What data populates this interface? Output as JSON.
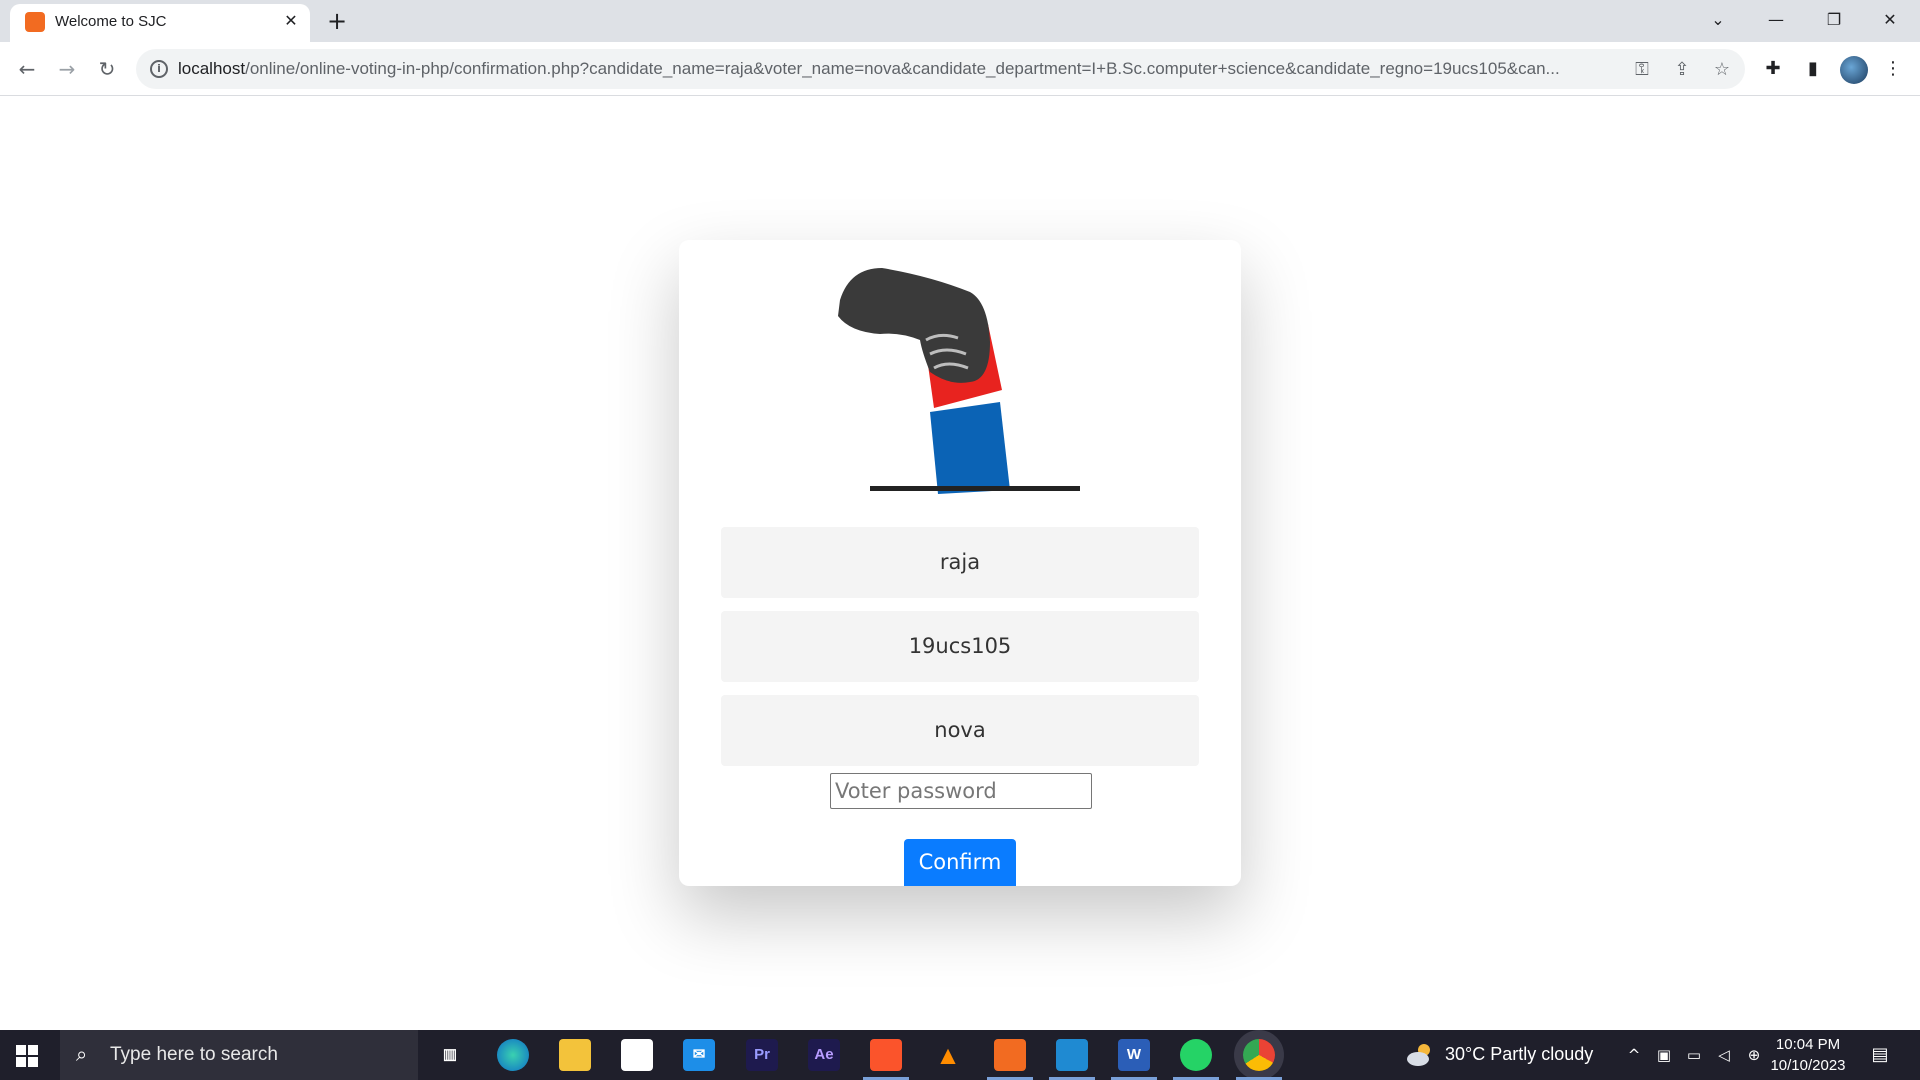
{
  "browser": {
    "tab_title": "Welcome to SJC",
    "tab_close": "✕",
    "new_tab": "+",
    "url_host": "localhost",
    "url_path": "/online/online-voting-in-php/confirmation.php?candidate_name=raja&voter_name=nova&candidate_department=I+B.Sc.computer+science&candidate_regno=19ucs105&can..."
  },
  "form": {
    "candidate_name": "raja",
    "candidate_regno": "19ucs105",
    "voter_name": "nova",
    "password_placeholder": "Voter password",
    "confirm_label": "Confirm"
  },
  "taskbar": {
    "search_placeholder": "Type here to search",
    "weather": "30°C  Partly cloudy",
    "time": "10:04 PM",
    "date": "10/10/2023",
    "apps": [
      "task-view",
      "edge",
      "file-explorer",
      "microsoft-store",
      "mail",
      "premiere-pro",
      "after-effects",
      "brave",
      "vlc",
      "xampp",
      "vscode",
      "word",
      "whatsapp",
      "chrome"
    ],
    "premiere_label": "Pr",
    "after_effects_label": "Ae",
    "word_label": "W"
  },
  "colors": {
    "accent": "#0a7cff",
    "field_bg": "#f4f4f4",
    "ballot_red": "#e8231f",
    "ballot_blue": "#0b63b5"
  }
}
